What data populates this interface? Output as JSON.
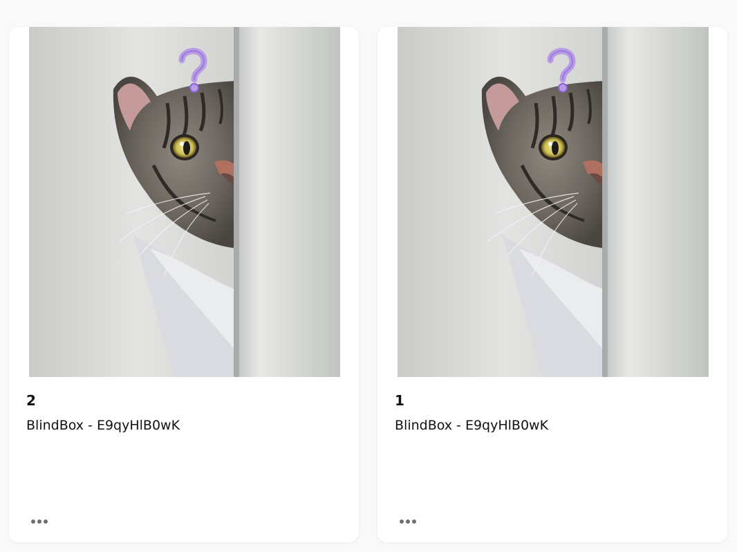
{
  "cards": [
    {
      "title": "2",
      "subtitle": "BlindBox - E9qyHlB0wK",
      "image_icon": "cat-peeking-question-mark",
      "menu_icon": "more-horizontal-icon"
    },
    {
      "title": "1",
      "subtitle": "BlindBox - E9qyHlB0wK",
      "image_icon": "cat-peeking-question-mark",
      "menu_icon": "more-horizontal-icon"
    }
  ],
  "colors": {
    "page_bg": "#f9f9f9",
    "card_bg": "#ffffff",
    "question_mark": "#b79be6",
    "menu_dots": "#6e6e6e"
  }
}
